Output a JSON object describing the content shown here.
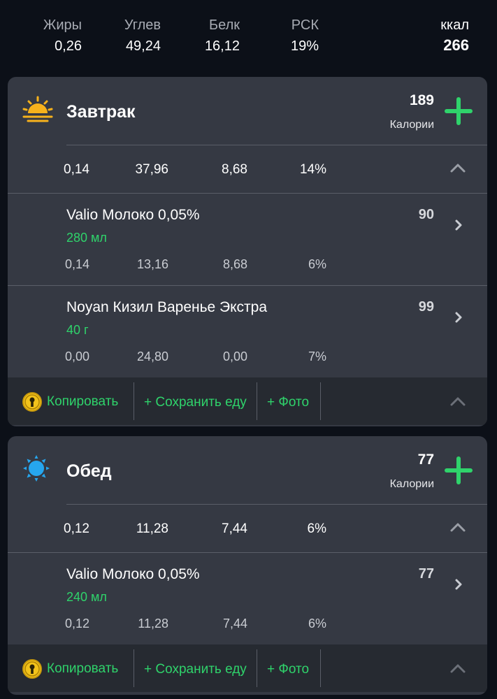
{
  "summary": {
    "fat_label": "Жиры",
    "fat_value": "0,26",
    "carbs_label": "Углев",
    "carbs_value": "49,24",
    "protein_label": "Белк",
    "protein_value": "16,12",
    "rsk_label": "РСК",
    "rsk_value": "19%",
    "kcal_label": "ккал",
    "kcal_value": "266"
  },
  "colors": {
    "accent_green": "#2fd36b",
    "card_bg": "#353943",
    "page_bg": "#0c1018"
  },
  "meals": [
    {
      "title": "Завтрак",
      "icon": "sunrise-icon",
      "kcal": "189",
      "kcal_label": "Калории",
      "macros": {
        "fat": "0,14",
        "carbs": "37,96",
        "protein": "8,68",
        "rsk": "14%"
      },
      "foods": [
        {
          "name": "Valio Молоко 0,05%",
          "qty": "280 мл",
          "kcal": "90",
          "macros": {
            "fat": "0,14",
            "carbs": "13,16",
            "protein": "8,68",
            "rsk": "6%"
          }
        },
        {
          "name": "Noyan Кизил Варенье Экстра",
          "qty": "40 г",
          "kcal": "99",
          "macros": {
            "fat": "0,00",
            "carbs": "24,80",
            "protein": "0,00",
            "rsk": "7%"
          }
        }
      ],
      "actions": {
        "copy": "Копировать",
        "save": "+ Сохранить еду",
        "photo": "+ Фото"
      }
    },
    {
      "title": "Обед",
      "icon": "sun-icon",
      "kcal": "77",
      "kcal_label": "Калории",
      "macros": {
        "fat": "0,12",
        "carbs": "11,28",
        "protein": "7,44",
        "rsk": "6%"
      },
      "foods": [
        {
          "name": "Valio Молоко 0,05%",
          "qty": "240 мл",
          "kcal": "77",
          "macros": {
            "fat": "0,12",
            "carbs": "11,28",
            "protein": "7,44",
            "rsk": "6%"
          }
        }
      ],
      "actions": {
        "copy": "Копировать",
        "save": "+ Сохранить еду",
        "photo": "+ Фото"
      }
    }
  ]
}
